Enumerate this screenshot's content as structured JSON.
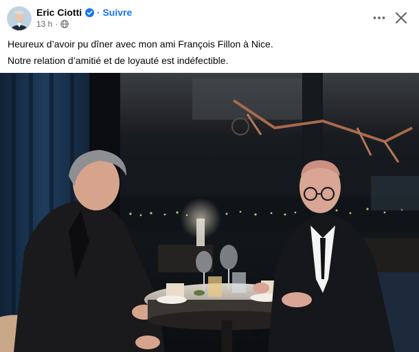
{
  "post": {
    "author": "Eric Ciotti",
    "follow_label": "Suivre",
    "dot": "·",
    "timestamp": "13 h",
    "meta_sep": "·",
    "text_lines": [
      "Heureux d’avoir pu dîner avec mon ami François Fillon à Nice.",
      "Notre relation d’amitié et de loyauté est indéfectible."
    ]
  },
  "icons": {
    "verified": "verified-badge-icon",
    "audience": "globe-icon",
    "more": "more-options-icon",
    "close": "close-icon"
  },
  "colors": {
    "brand_blue": "#1877f2",
    "text_primary": "#050505",
    "text_secondary": "#65676b"
  }
}
